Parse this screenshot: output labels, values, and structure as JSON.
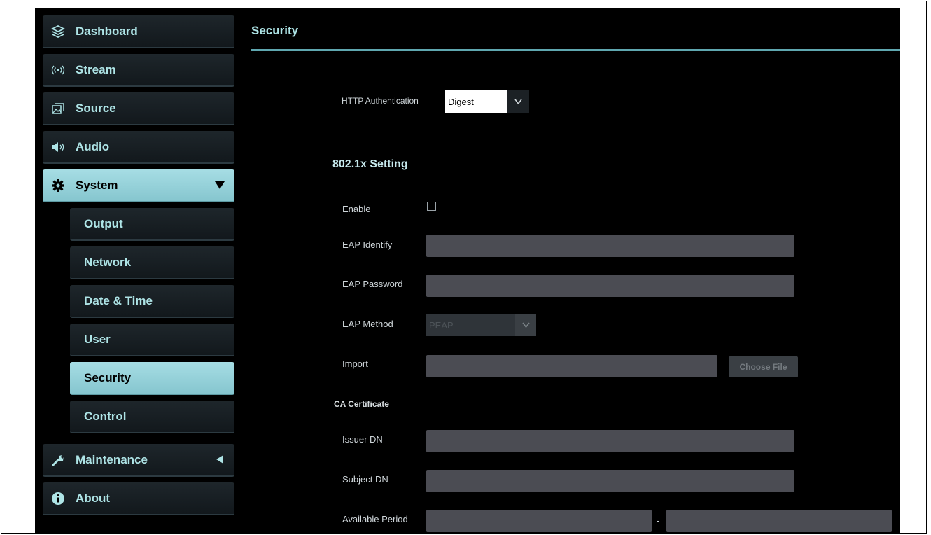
{
  "sidebar": {
    "items": [
      {
        "label": "Dashboard",
        "icon": "layers-icon"
      },
      {
        "label": "Stream",
        "icon": "broadcast-icon"
      },
      {
        "label": "Source",
        "icon": "image-source-icon"
      },
      {
        "label": "Audio",
        "icon": "speaker-icon"
      },
      {
        "label": "System",
        "icon": "gear-icon",
        "expanded": true
      },
      {
        "label": "Maintenance",
        "icon": "wrench-icon",
        "expanded": false
      },
      {
        "label": "About",
        "icon": "info-icon"
      }
    ],
    "system_children": [
      "Output",
      "Network",
      "Date & Time",
      "User",
      "Security",
      "Control"
    ],
    "active_item": "Security"
  },
  "page": {
    "title": "Security"
  },
  "form": {
    "http_auth_label": "HTTP Authentication",
    "http_auth_value": "Digest",
    "dot1x_heading": "802.1x Setting",
    "enable_label": "Enable",
    "enable_checked": false,
    "eap_identify_label": "EAP Identify",
    "eap_identify_value": "",
    "eap_password_label": "EAP Password",
    "eap_password_value": "",
    "eap_method_label": "EAP Method",
    "eap_method_value": "PEAP",
    "import_label": "Import",
    "choose_file_label": "Choose File",
    "ca_cert_heading": "CA Certificate",
    "issuer_dn_label": "Issuer DN",
    "subject_dn_label": "Subject DN",
    "available_period_label": "Available Period",
    "period_separator": "-"
  },
  "colors": {
    "accent": "#aee4e6",
    "active_bg": "#9bd4dc",
    "field_bg": "#4b4c53",
    "background": "#000000"
  }
}
